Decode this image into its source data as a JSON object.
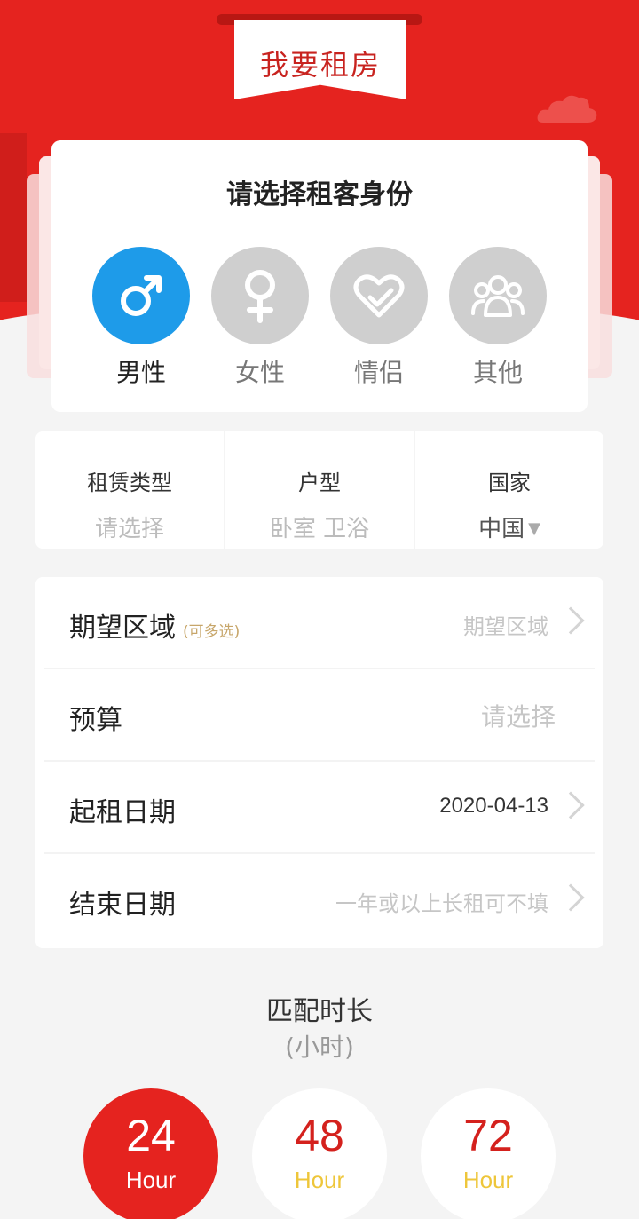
{
  "header": {
    "title": "我要租房"
  },
  "identity": {
    "title": "请选择租客身份",
    "options": [
      {
        "label": "男性",
        "icon": "male-icon",
        "selected": true
      },
      {
        "label": "女性",
        "icon": "female-icon",
        "selected": false
      },
      {
        "label": "情侣",
        "icon": "couple-heart-icon",
        "selected": false
      },
      {
        "label": "其他",
        "icon": "group-icon",
        "selected": false
      }
    ]
  },
  "filters": [
    {
      "label": "租赁类型",
      "value": "请选择"
    },
    {
      "label": "户型",
      "value": "卧室 卫浴"
    },
    {
      "label": "国家",
      "value": "中国"
    }
  ],
  "form": {
    "area": {
      "label": "期望区域",
      "hint": "(可多选)",
      "value": "期望区域"
    },
    "budget": {
      "label": "预算",
      "value": "请选择"
    },
    "start_date": {
      "label": "起租日期",
      "value": "2020-04-13"
    },
    "end_date": {
      "label": "结束日期",
      "value": "一年或以上长租可不填"
    }
  },
  "match": {
    "title": "匹配时长",
    "unit": "(小时)",
    "options": [
      {
        "value": "24",
        "unit": "Hour",
        "selected": true
      },
      {
        "value": "48",
        "unit": "Hour",
        "selected": false
      },
      {
        "value": "72",
        "unit": "Hour",
        "selected": false
      }
    ]
  },
  "colors": {
    "brand_red": "#e5231f",
    "selected_blue": "#1e9be9",
    "unselected_gray": "#cfcfcf",
    "hour_yellow": "#eec63a"
  }
}
